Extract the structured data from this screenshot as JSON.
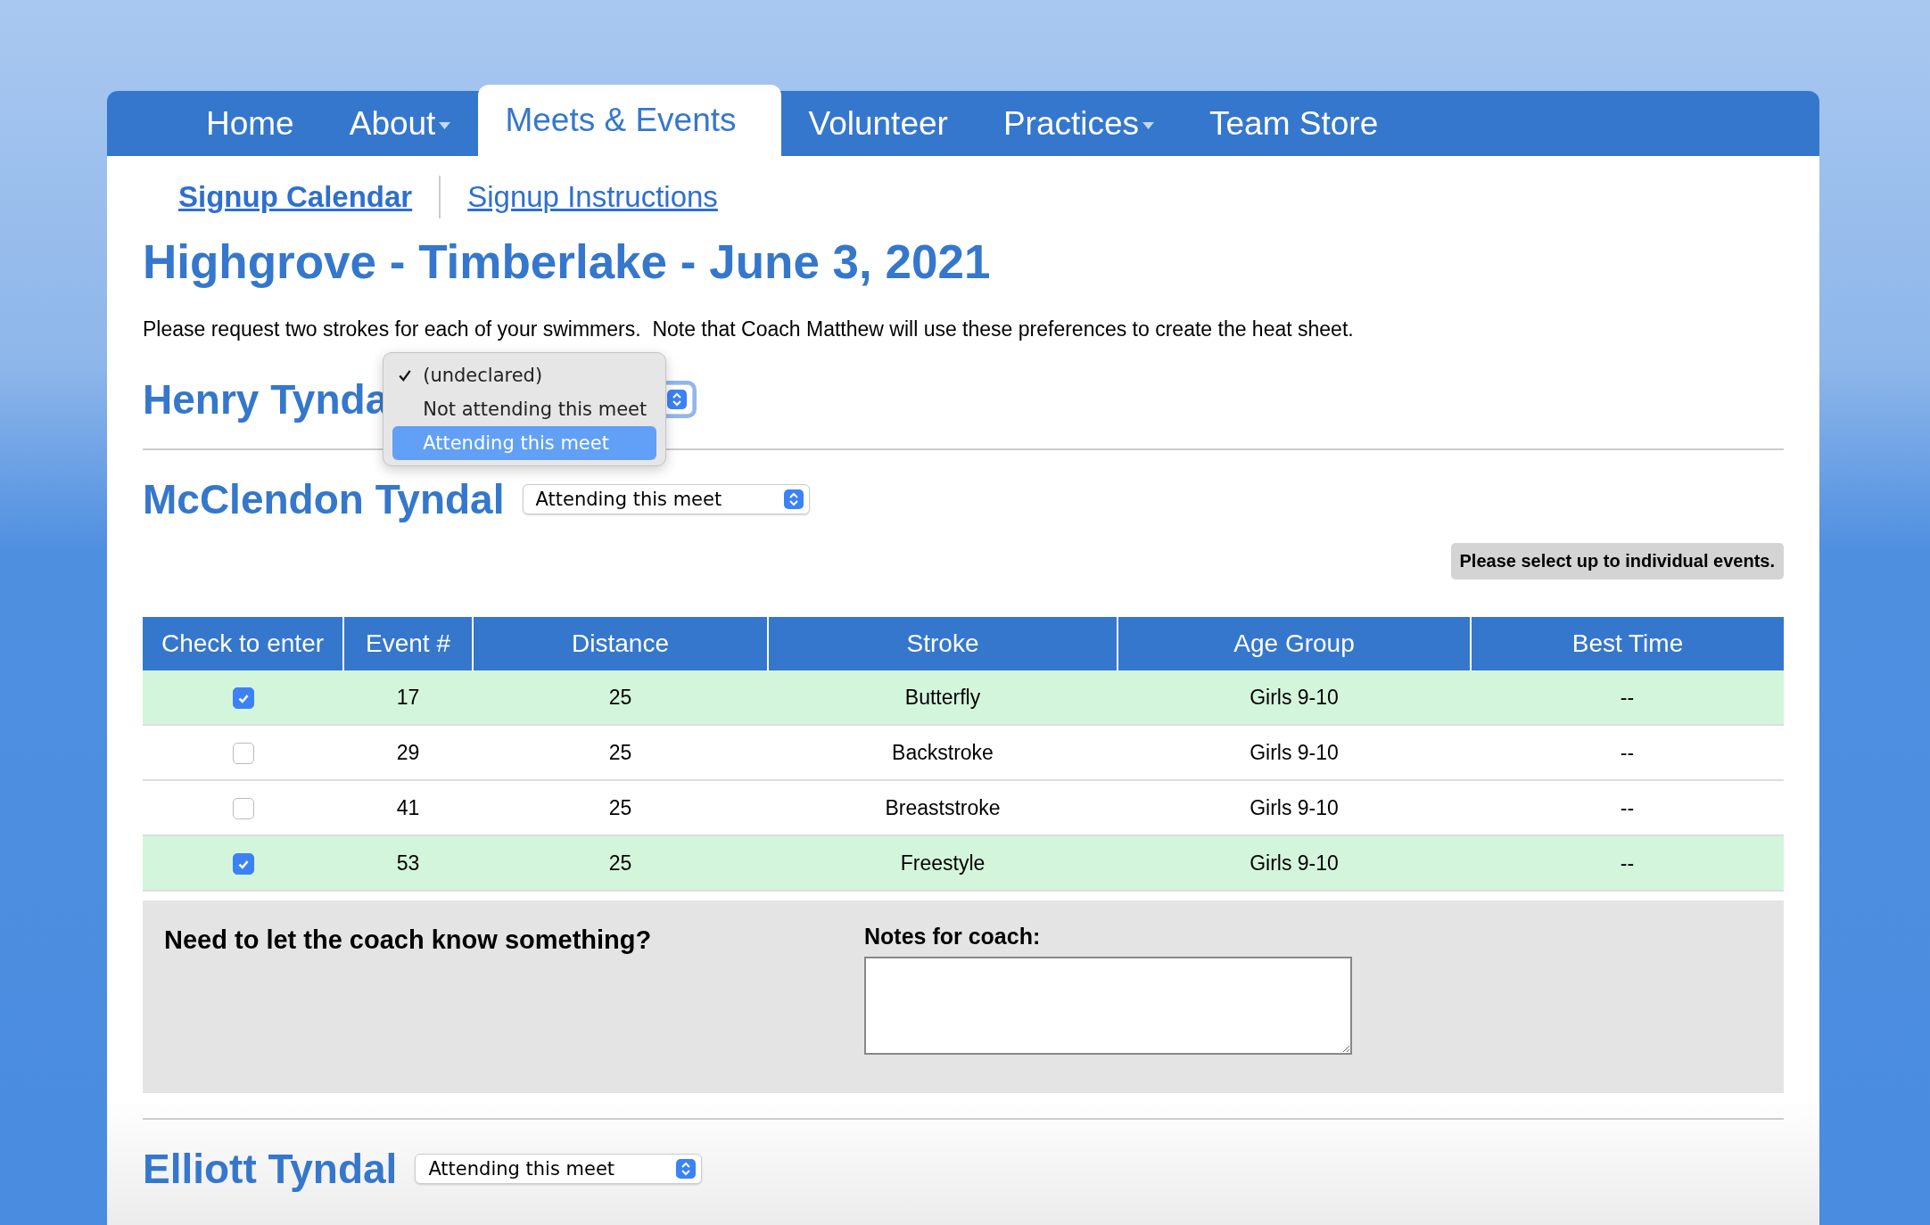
{
  "nav": [
    {
      "label": "Home",
      "selected": false,
      "dropdown": false
    },
    {
      "label": "About",
      "selected": false,
      "dropdown": true
    },
    {
      "label": "Meets & Events",
      "selected": true,
      "dropdown": false
    },
    {
      "label": "Volunteer",
      "selected": false,
      "dropdown": false
    },
    {
      "label": "Practices",
      "selected": false,
      "dropdown": true
    },
    {
      "label": "Team Store",
      "selected": false,
      "dropdown": false
    }
  ],
  "subnav": [
    {
      "label": "Signup Calendar",
      "selected": true
    },
    {
      "label": "Signup Instructions",
      "selected": false
    }
  ],
  "title": "Highgrove - Timberlake - June 3, 2021",
  "intro": "Please request two strokes for each of your swimmers.  Note that Coach Matthew will use these preferences to create the heat sheet.",
  "swimmers": [
    {
      "name": "Henry Tynda",
      "menu": {
        "options": [
          {
            "label": "(undeclared)",
            "checked": true,
            "selected": false
          },
          {
            "label": "Not attending this meet",
            "checked": false,
            "selected": false
          },
          {
            "label": "Attending this meet",
            "checked": false,
            "selected": true
          }
        ]
      }
    },
    {
      "name": "McClendon Tyndal",
      "select": {
        "value": "Attending this meet"
      },
      "notice": "Please select up to individual events.",
      "table": {
        "columns": [
          "Check to enter",
          "Event #",
          "Distance",
          "Stroke",
          "Age Group",
          "Best Time"
        ],
        "rows": [
          {
            "checked": true,
            "cells": [
              "",
              "17",
              "25",
              "Butterfly",
              "Girls 9-10",
              "--"
            ]
          },
          {
            "checked": false,
            "cells": [
              "",
              "29",
              "25",
              "Backstroke",
              "Girls 9-10",
              "--"
            ]
          },
          {
            "checked": false,
            "cells": [
              "",
              "41",
              "25",
              "Breaststroke",
              "Girls 9-10",
              "--"
            ]
          },
          {
            "checked": true,
            "cells": [
              "",
              "53",
              "25",
              "Freestyle",
              "Girls 9-10",
              "--"
            ]
          }
        ]
      },
      "notes": {
        "prompt": "Need to let the coach know something?",
        "label": "Notes for coach:"
      }
    },
    {
      "name": "Elliott Tyndal",
      "select": {
        "value": "Attending this meet"
      }
    }
  ]
}
